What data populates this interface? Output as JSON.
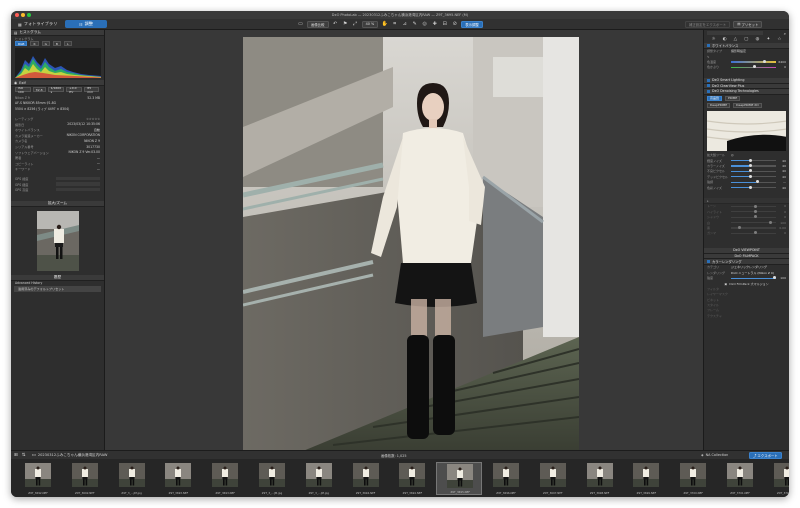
{
  "window": {
    "title": "DxO PhotoLab — 20230312ふみこちゃん横浜港湾区内RAW — Z9T_3695.NEF (M)"
  },
  "toolbar": {
    "tabs": [
      {
        "label": "フォトライブラリ"
      },
      {
        "label": "調整"
      }
    ],
    "compare_label": "画像比較",
    "zoom_label": "40 %",
    "apply_label": "表示調整",
    "export_label": "補正設定をエクスポート",
    "preset_label": "プリセット"
  },
  "left": {
    "histogram_title": "ヒストグラム",
    "histogram_sub": "ヒストグラム",
    "channels": [
      "RGB",
      "R",
      "G",
      "B",
      "L"
    ],
    "exif_title": "Exif",
    "exif_chips": [
      "ISO 100",
      "f/2.8",
      "1/1600 s",
      "+0.0 EV",
      "85 mm"
    ],
    "file_name": "Nikon Z 9",
    "file_size": "52.3 MB",
    "lens": "AF-S NIKKOR 85mm f/1.8G",
    "dims": "5504 × 8256 (ライブ 4497 × 8304)",
    "meta": [
      {
        "k": "レーティング",
        "v": "☆☆☆☆☆"
      },
      {
        "k": "撮影日",
        "v": "2023/03/12 10:35:06"
      },
      {
        "k": "ホワイトバランス",
        "v": "自動"
      },
      {
        "k": "カメラ製造メーカー",
        "v": "NIKON CORPORATION"
      },
      {
        "k": "カメラ名",
        "v": "NIKON Z 9"
      },
      {
        "k": "シリアル番号",
        "v": "3017730"
      },
      {
        "k": "ソフトウェアバージョン",
        "v": "NIKON Z 9 Ver.03.00"
      },
      {
        "k": "著者",
        "v": "—"
      },
      {
        "k": "コピーライト",
        "v": "—"
      },
      {
        "k": "キーワード",
        "v": "—"
      }
    ],
    "gps": [
      {
        "k": "GPS 緯度"
      },
      {
        "k": "GPS 経度"
      },
      {
        "k": "GPS 高度"
      }
    ],
    "nav_title": "拡大/ズーム",
    "history_title": "履歴",
    "history_items": [
      "Advanced History",
      "適用済みのデフォルトプリセット"
    ]
  },
  "right": {
    "wb_title": "ホワイトバランス",
    "wb_rows": [
      {
        "label": "調整タイプ",
        "value": "撮影時設定"
      },
      {
        "label": "色温度",
        "value": "6400"
      },
      {
        "label": "色かぶり",
        "value": "0"
      }
    ],
    "smart_lighting": "DxO Smart Lighting",
    "clearview": "DxO ClearView Plus",
    "denoise_title": "DxO Denoising Technologies",
    "denoise_modes": [
      "高品質",
      "PRIME",
      "DeepPRIME",
      "DeepPRIME XD"
    ],
    "mag_label": "拡大鏡ツール",
    "denoise_sliders": [
      {
        "label": "輝度ノイズ",
        "value": "40"
      },
      {
        "label": "カラーノイズ",
        "value": "40"
      },
      {
        "label": "不良ピクセル",
        "value": "40"
      },
      {
        "label": "デッドピクセル",
        "value": "40"
      },
      {
        "label": "強調",
        "value": "—"
      },
      {
        "label": "色彩ノイズ",
        "value": "40"
      }
    ],
    "tone_sliders": [
      {
        "label": "トーン",
        "value": "0"
      },
      {
        "label": "ハイライト",
        "value": "0"
      },
      {
        "label": "シャドウ",
        "value": "0"
      },
      {
        "label": "白",
        "value": "100"
      },
      {
        "label": "黒",
        "value": "0.00"
      },
      {
        "label": "ガンマ",
        "value": "0"
      }
    ],
    "viewpoint": "DxO VIEWPOINT",
    "filmpack": "DxO FILMPACK",
    "color_title": "カラーレンダリング",
    "color_rows": [
      {
        "label": "カテゴリ",
        "value": "ジェネリックレンダリング"
      },
      {
        "label": "レンダリング",
        "value": "DxO ニュートラル (Nikon Z 9)"
      },
      {
        "label": "強度",
        "value": "100"
      }
    ],
    "fp_item": "DxO FilmPack 大マルジョン",
    "tail_items": [
      "フィルタ",
      "レイヤーマスク",
      "ビネット",
      "スタイル",
      "フレーム",
      "テクスチャ"
    ]
  },
  "filmbar": {
    "folder": "20230312ふみこちゃん横浜港湾区内RAW",
    "count": "画像枚数:",
    "count_value": "1,025",
    "collection": "NA Collection",
    "export": "エクスポート"
  },
  "filmstrip": [
    "Z9T_3692.NEF",
    "Z9T_3692.NEF",
    "Z9T_3_…JM.jpg",
    "Z9T_3693.NEF",
    "Z9T_3693.NEF",
    "Z9T_3_…JM.jpg",
    "Z9T_3_…JM.jpg",
    "Z9T_3694.NEF",
    "Z9T_3694.NEF",
    "Z9T_3695.NEF",
    "Z9T_3696.NEF",
    "Z9T_3697.NEF",
    "Z9T_3698.NEF",
    "Z9T_3699.NEF",
    "Z9T_3700.NEF",
    "Z9T_3701.NEF",
    "Z9T_3702.NEF"
  ],
  "colors": {
    "accent": "#2a6fb8",
    "panel": "#2e2e2e",
    "viewer": "#383838"
  }
}
